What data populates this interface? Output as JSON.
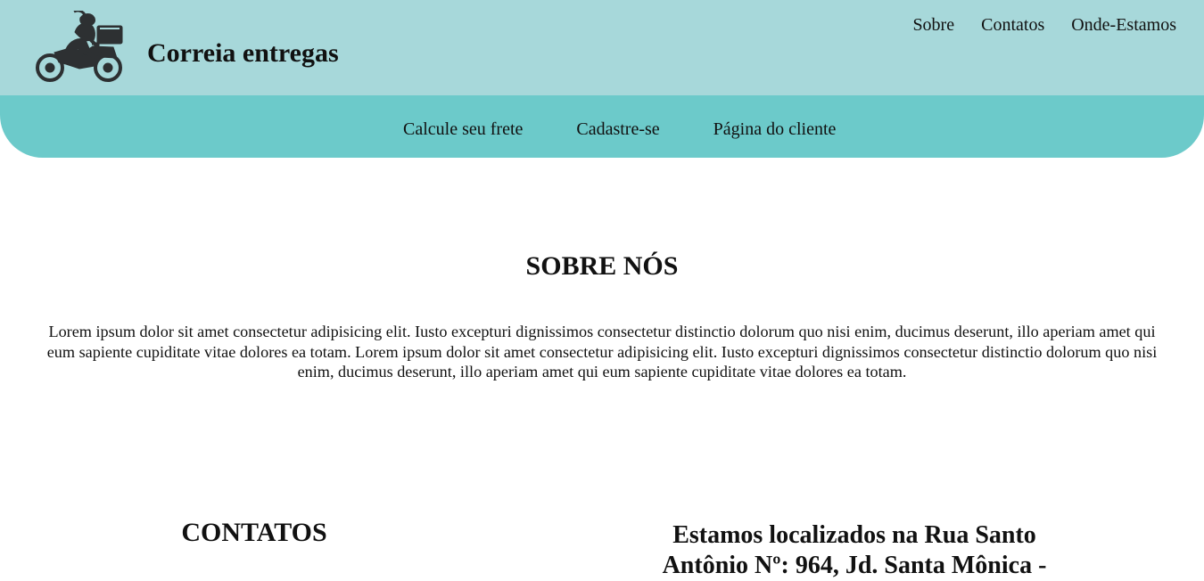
{
  "header": {
    "brand": "Correia entregas",
    "logo_icon": "motorcycle-delivery-icon",
    "nav_links": [
      "Sobre",
      "Contatos",
      "Onde-Estamos"
    ]
  },
  "subnav": {
    "links": [
      "Calcule seu frete",
      "Cadastre-se",
      "Página do cliente"
    ]
  },
  "about": {
    "title": "SOBRE NÓS",
    "text": "Lorem ipsum dolor sit amet consectetur adipisicing elit. Iusto excepturi dignissimos consectetur distinctio dolorum quo nisi enim, ducimus deserunt, illo aperiam amet qui eum sapiente cupiditate vitae dolores ea totam. Lorem ipsum dolor sit amet consectetur adipisicing elit. Iusto excepturi dignissimos consectetur distinctio dolorum quo nisi enim, ducimus deserunt, illo aperiam amet qui eum sapiente cupiditate vitae dolores ea totam."
  },
  "contacts": {
    "title": "CONTATOS"
  },
  "location": {
    "text": "Estamos localizados na Rua Santo Antônio Nº: 964, Jd. Santa Mônica -"
  },
  "colors": {
    "top_bar": "#a7d8da",
    "sub_bar": "#6ccaca",
    "text": "#111111",
    "background": "#ffffff"
  }
}
